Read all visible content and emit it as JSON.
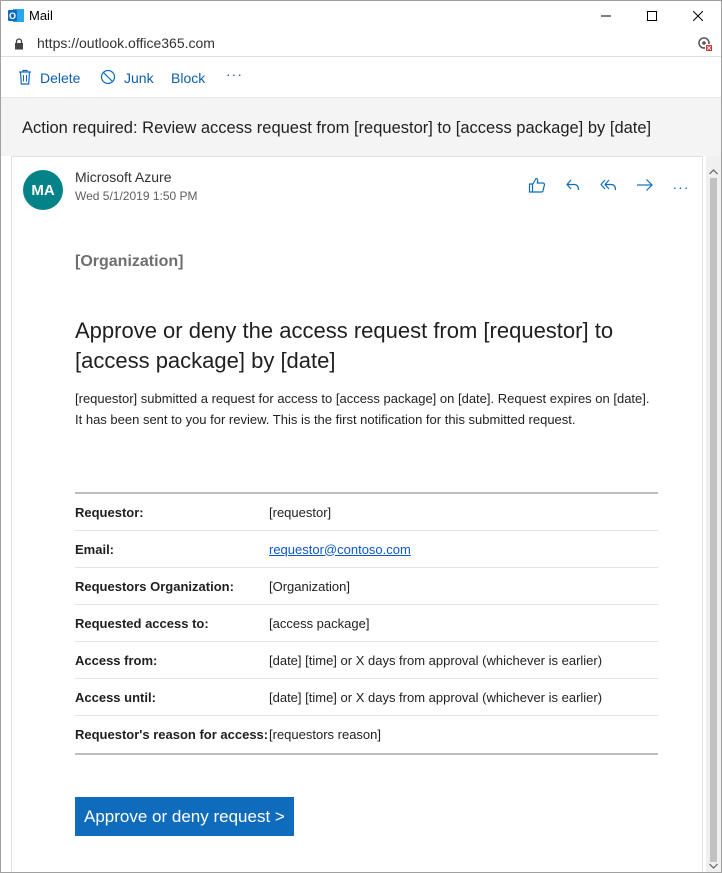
{
  "window": {
    "title": "Mail",
    "url": "https://outlook.office365.com"
  },
  "toolbar": {
    "delete_label": "Delete",
    "junk_label": "Junk",
    "block_label": "Block",
    "more_label": "···"
  },
  "message": {
    "subject": "Action required: Review access request from [requestor] to [access package] by [date]",
    "avatar_initials": "MA",
    "avatar_color": "#038387",
    "sender": "Microsoft Azure",
    "date": "Wed 5/1/2019 1:50 PM",
    "more_label": "···"
  },
  "email": {
    "organization": "[Organization]",
    "headline": "Approve or deny the access request from [requestor] to [access package] by [date]",
    "body": "[requestor] submitted a request for access to [access package] on [date]. Request expires on [date]. It has been sent to you for review. This is the first notification for this submitted request.",
    "details": [
      {
        "label": "Requestor:",
        "value": "[requestor]"
      },
      {
        "label": "Email:",
        "value": "requestor@contoso.com"
      },
      {
        "label": "Requestors Organization:",
        "value": "[Organization]"
      },
      {
        "label": "Requested access to:",
        "value": "[access package]"
      },
      {
        "label": "Access from:",
        "value": "[date] [time] or X days from approval (whichever is earlier)"
      },
      {
        "label": "Access until:",
        "value": "[date] [time] or X days from approval (whichever is earlier)"
      },
      {
        "label": "Requestor's reason for access:",
        "value": "[requestors reason]"
      }
    ],
    "cta_label": "Approve or deny request >"
  },
  "colors": {
    "accent": "#0f6cbd",
    "cta_background": "#0f6cbd",
    "link": "#0b57d0"
  },
  "icons": {
    "app": "outlook-icon",
    "lock": "lock-icon",
    "extension": "extension-blocked-icon",
    "delete": "trash-icon",
    "junk": "block-circle-icon",
    "like": "thumbs-up-icon",
    "reply": "reply-icon",
    "reply_all": "reply-all-icon",
    "forward": "forward-icon"
  }
}
